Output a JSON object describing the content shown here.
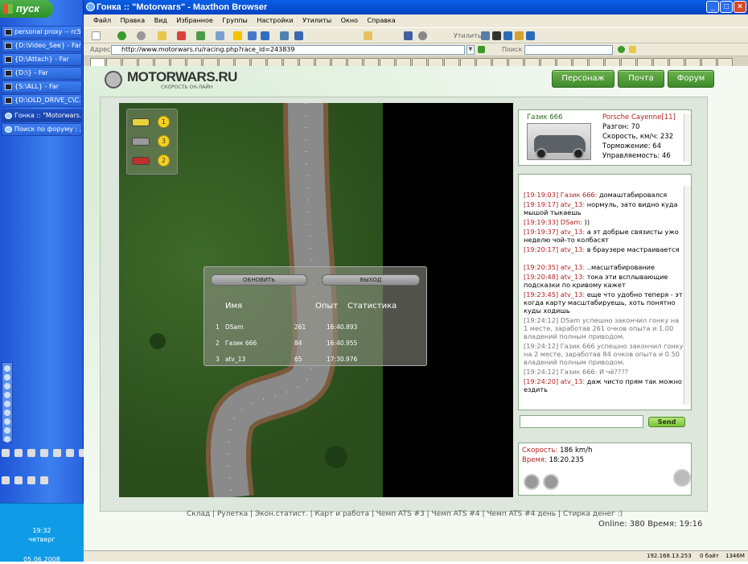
{
  "taskbar": {
    "start_label": "пуск",
    "items": [
      {
        "label": "personal proxy -- rc5..."
      },
      {
        "label": "{D:\\Video_See} - Far"
      },
      {
        "label": "{D:\\Attach} - Far"
      },
      {
        "label": "{D:\\} - Far"
      },
      {
        "label": "{S:\\ALL} - Far"
      },
      {
        "label": "{D:\\OLD_DRIVE_C\\C..."
      },
      {
        "label": "Гонка :: \"Motorwars..."
      },
      {
        "label": "Поиск по форуму : ..."
      }
    ],
    "clock": {
      "time": "19:32",
      "day": "четверг",
      "date": "05.06.2008"
    }
  },
  "browser": {
    "title": "Гонка :: \"Motorwars\" - Maxthon Browser",
    "menu": [
      "Файл",
      "Правка",
      "Вид",
      "Избранное",
      "Группы",
      "Настройки",
      "Утилиты",
      "Окно",
      "Справка"
    ],
    "utilities_label": "Утилиты",
    "address_label": "Адрес",
    "address": "http://www.motorwars.ru/racing.php?race_id=243839",
    "search_label": "Поиск",
    "status": {
      "ip": "192.168.13.253",
      "bytes": "0 байт",
      "mem": "1346M"
    }
  },
  "site": {
    "logo": "MOTORWARS.RU",
    "logo_sub": "СКОРОСТЬ ОН-ЛАЙН",
    "nav": [
      "Персонаж",
      "Почта",
      "Форум"
    ]
  },
  "game": {
    "minimap": [
      {
        "pos": "1",
        "color": "#e8d23a"
      },
      {
        "pos": "3",
        "color": "#9a9a9a"
      },
      {
        "pos": "2",
        "color": "#c0302a"
      }
    ],
    "buttons": {
      "refresh": "ОБНОВИТЬ",
      "exit": "ВЫХОД"
    },
    "results_header": {
      "name": "Имя",
      "exp": "Опыт",
      "stats": "Статистика"
    },
    "results": [
      {
        "n": "1",
        "name": "DSam",
        "exp": "261",
        "time": "16:40.893"
      },
      {
        "n": "2",
        "name": "Газик 666",
        "exp": "84",
        "time": "16:40.955"
      },
      {
        "n": "3",
        "name": "atv_13",
        "exp": "65",
        "time": "17:30.976"
      }
    ]
  },
  "car": {
    "owner": "Газик 666",
    "model": "Porsche Cayenne[11]",
    "accel": "Разгон: 70",
    "speed": "Скорость, км/ч: 232",
    "brake": "Торможение: 64",
    "handling": "Управляемость: 46"
  },
  "chat": [
    {
      "time": "[19:19:03]",
      "nick": "Газик 666:",
      "text": "домаштабировался"
    },
    {
      "time": "[19:19:17]",
      "nick": "atv_13:",
      "text": "нормуль, зато видно куда мышой тыкаешь"
    },
    {
      "time": "[19:19:33]",
      "nick": "DSam:",
      "text": "))"
    },
    {
      "time": "[19:19:37]",
      "nick": "atv_13:",
      "text": "а эт добрые связисты ужо неделю чой-то колбасят"
    },
    {
      "time": "[19:20:17]",
      "nick": "atv_13:",
      "text": "в браузере мастраивается"
    },
    {
      "time": "[19:20:35]",
      "nick": "atv_13:",
      "text": "..масштабирование"
    },
    {
      "time": "[19:20:48]",
      "nick": "atv_13:",
      "text": "тока эти всплывающие подсказки по кривому кажет"
    },
    {
      "time": "[19:23:45]",
      "nick": "atv_13:",
      "text": "еще что удобно теперя - эт когда карту масштабируешь, хоть понятно куды ходишь"
    },
    {
      "time": "",
      "nick": "",
      "text": "[19:24:12] DSam успешно закончил гонку на 1 месте, заработав 261 очков опыта и 1.00 владений полным приводом."
    },
    {
      "time": "",
      "nick": "",
      "text": "[19:24:12] Газик 666 успешно закончил гонку на 2 месте, заработав 84 очков опыта и 0.50 владений полным приводом."
    },
    {
      "time": "",
      "nick": "",
      "text": "[19:24:12] Газик 666: И чё????"
    },
    {
      "time": "[19:24:20]",
      "nick": "atv_13:",
      "text": "даж чисто прям так можно ездить"
    }
  ],
  "send_label": "Send",
  "race": {
    "speed_label": "Скорость:",
    "speed_value": "186 km/h",
    "time_label": "Время:",
    "time_value": "18:20.235"
  },
  "footer": {
    "links": "Склад | Рулетка | Экон.статист. | Карт и работа | Чемп ATS #3 | Чемп ATS #4 | Чемп ATS #4 день | Стирка денег :)",
    "online": "Online: 380  Время: 19:16"
  }
}
